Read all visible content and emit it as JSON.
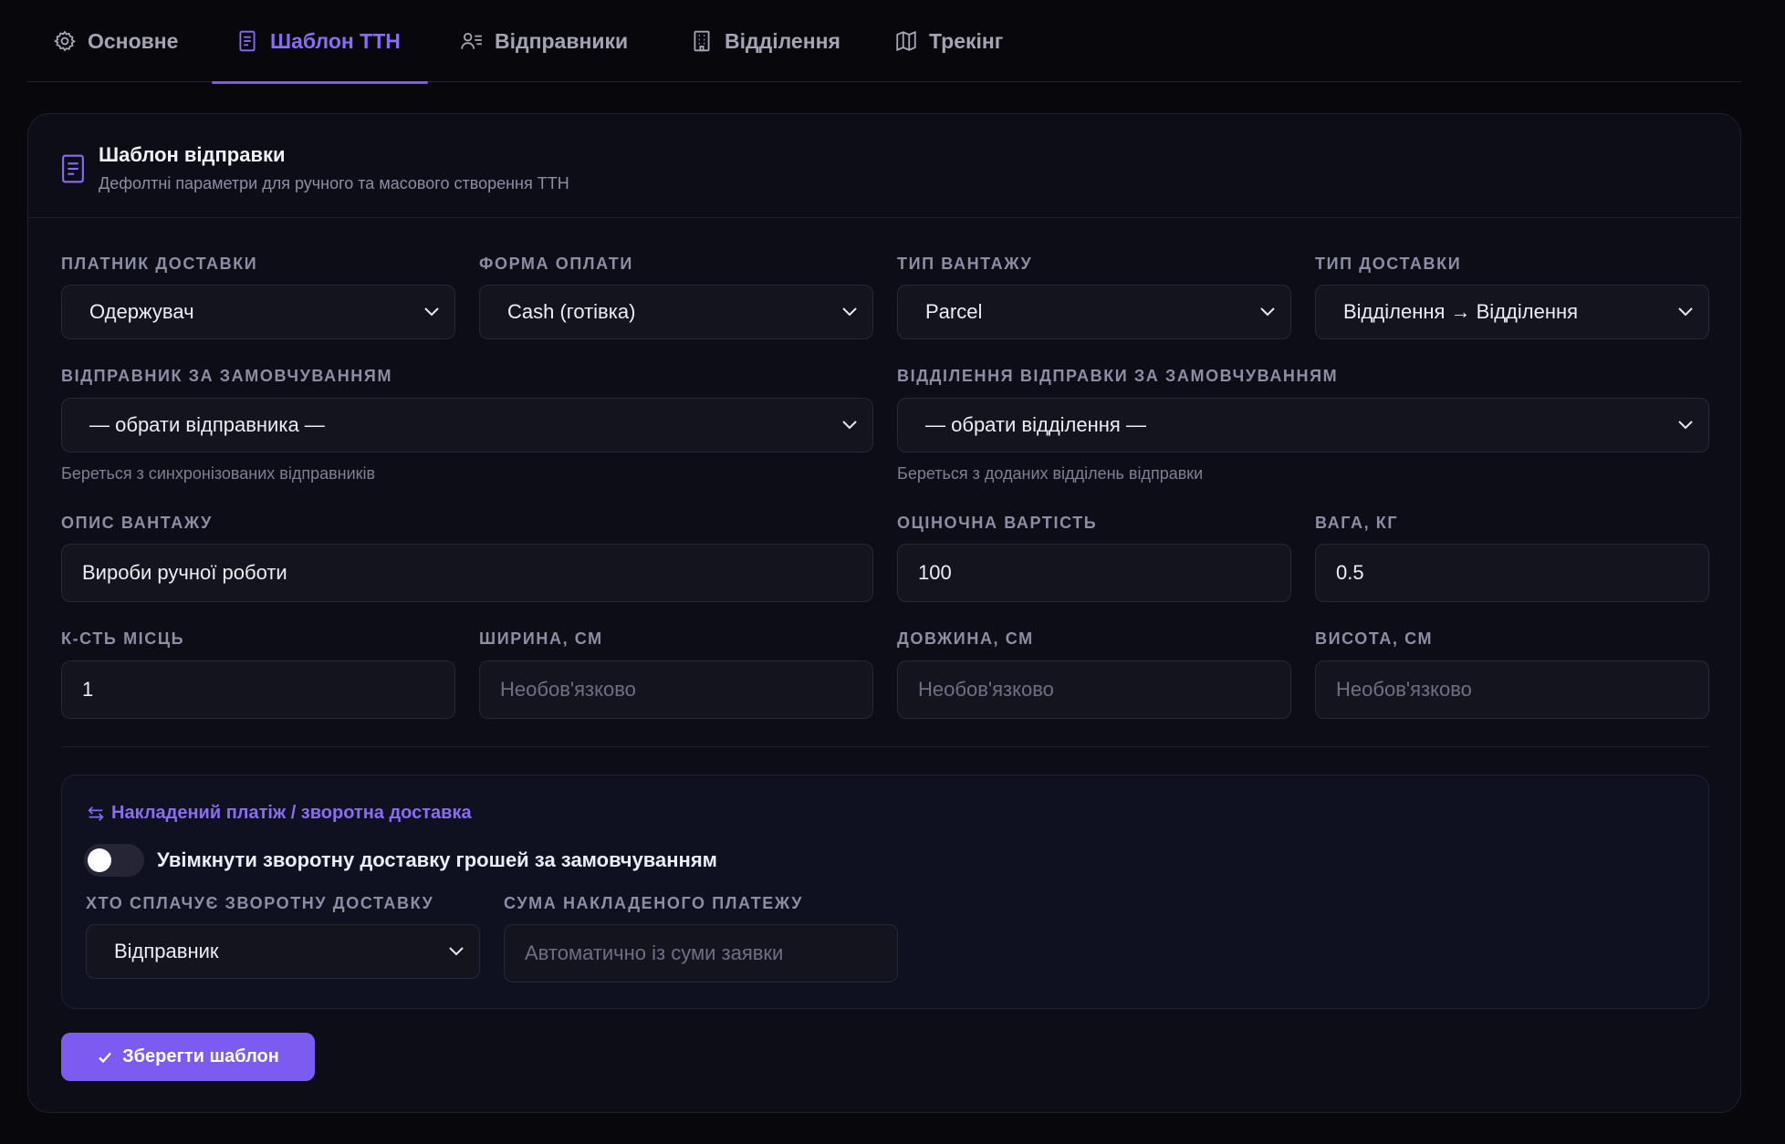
{
  "tabs": [
    {
      "label": "Основне",
      "icon": "gear-icon",
      "active": false
    },
    {
      "label": "Шаблон ТТН",
      "icon": "document-icon",
      "active": true
    },
    {
      "label": "Відправники",
      "icon": "users-icon",
      "active": false
    },
    {
      "label": "Відділення",
      "icon": "building-icon",
      "active": false
    },
    {
      "label": "Трекінг",
      "icon": "map-icon",
      "active": false
    }
  ],
  "card": {
    "title": "Шаблон відправки",
    "subtitle": "Дефолтні параметри для ручного та масового створення ТТН"
  },
  "fields": {
    "payer": {
      "label": "Платник доставки",
      "value": "Одержувач"
    },
    "payment_form": {
      "label": "Форма оплати",
      "value": "Cash (готівка)"
    },
    "cargo_type": {
      "label": "Тип вантажу",
      "value": "Parcel"
    },
    "delivery_type": {
      "label": "Тип доставки",
      "value": "Відділення → Відділення"
    },
    "default_sender": {
      "label": "Відправник за замовчуванням",
      "value": "— обрати відправника —",
      "hint": "Береться з синхронізованих відправників"
    },
    "default_branch": {
      "label": "Відділення відправки за замовчуванням",
      "value": "— обрати відділення —",
      "hint": "Береться з доданих відділень відправки"
    },
    "cargo_description": {
      "label": "Опис вантажу",
      "value": "Вироби ручної роботи"
    },
    "declared_value": {
      "label": "Оціночна вартість",
      "value": "100"
    },
    "weight": {
      "label": "Вага, кг",
      "value": "0.5"
    },
    "seats": {
      "label": "К-сть місць",
      "value": "1"
    },
    "width": {
      "label": "Ширина, см",
      "placeholder": "Необов'язково"
    },
    "length": {
      "label": "Довжина, см",
      "placeholder": "Необов'язково"
    },
    "height": {
      "label": "Висота, см",
      "placeholder": "Необов'язково"
    }
  },
  "cod": {
    "title": "Накладений платіж / зворотна доставка",
    "toggle_label": "Увімкнути зворотну доставку грошей за замовчуванням",
    "toggle_on": false,
    "payer_label": "Хто сплачує зворотну доставку",
    "payer_value": "Відправник",
    "amount_label": "Сума накладеного платежу",
    "amount_placeholder": "Автоматично із суми заявки"
  },
  "save_label": "Зберегти шаблон",
  "colors": {
    "accent": "#7c5cf0",
    "background": "#07070c",
    "card": "#0d0d17"
  }
}
